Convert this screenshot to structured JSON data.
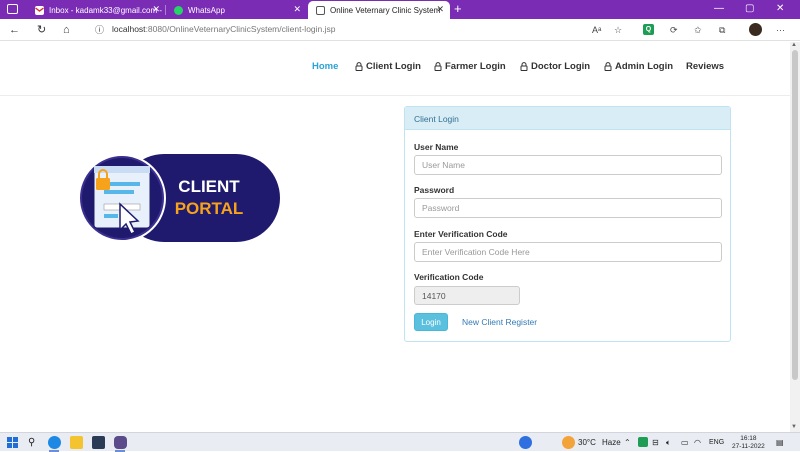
{
  "browser": {
    "tabs": [
      {
        "title": "Inbox - kadamk33@gmail.com -"
      },
      {
        "title": "WhatsApp"
      },
      {
        "title": "Online Veternary Clinic System"
      }
    ],
    "url_host": "localhost",
    "url_path": ":8080/OnlineVeternaryClinicSystem/client-login.jsp"
  },
  "nav": {
    "home": "Home",
    "client_login": "Client Login",
    "farmer_login": "Farmer Login",
    "doctor_login": "Doctor Login",
    "admin_login": "Admin Login",
    "reviews": "Reviews"
  },
  "logo": {
    "line1": "CLIENT",
    "line2": "PORTAL"
  },
  "form": {
    "panel_title": "Client Login",
    "username_label": "User Name",
    "username_placeholder": "User Name",
    "password_label": "Password",
    "password_placeholder": "Password",
    "verify_label": "Enter Verification Code",
    "verify_placeholder": "Enter Verification Code Here",
    "code_label": "Verification Code",
    "code_value": "14170",
    "login_button": "Login",
    "register_link": "New Client Register"
  },
  "taskbar": {
    "weather_temp": "30°C",
    "weather_desc": "Haze",
    "lang": "ENG",
    "time": "16:18",
    "date": "27-11-2022"
  },
  "colors": {
    "tab_bar": "#7b2cb5",
    "nav_active": "#2ba3d6",
    "panel_head": "#d9edf7",
    "login_button": "#5bc0de",
    "link": "#337ab7",
    "logo_navy": "#1f1a6e",
    "logo_orange": "#f7a21b"
  }
}
